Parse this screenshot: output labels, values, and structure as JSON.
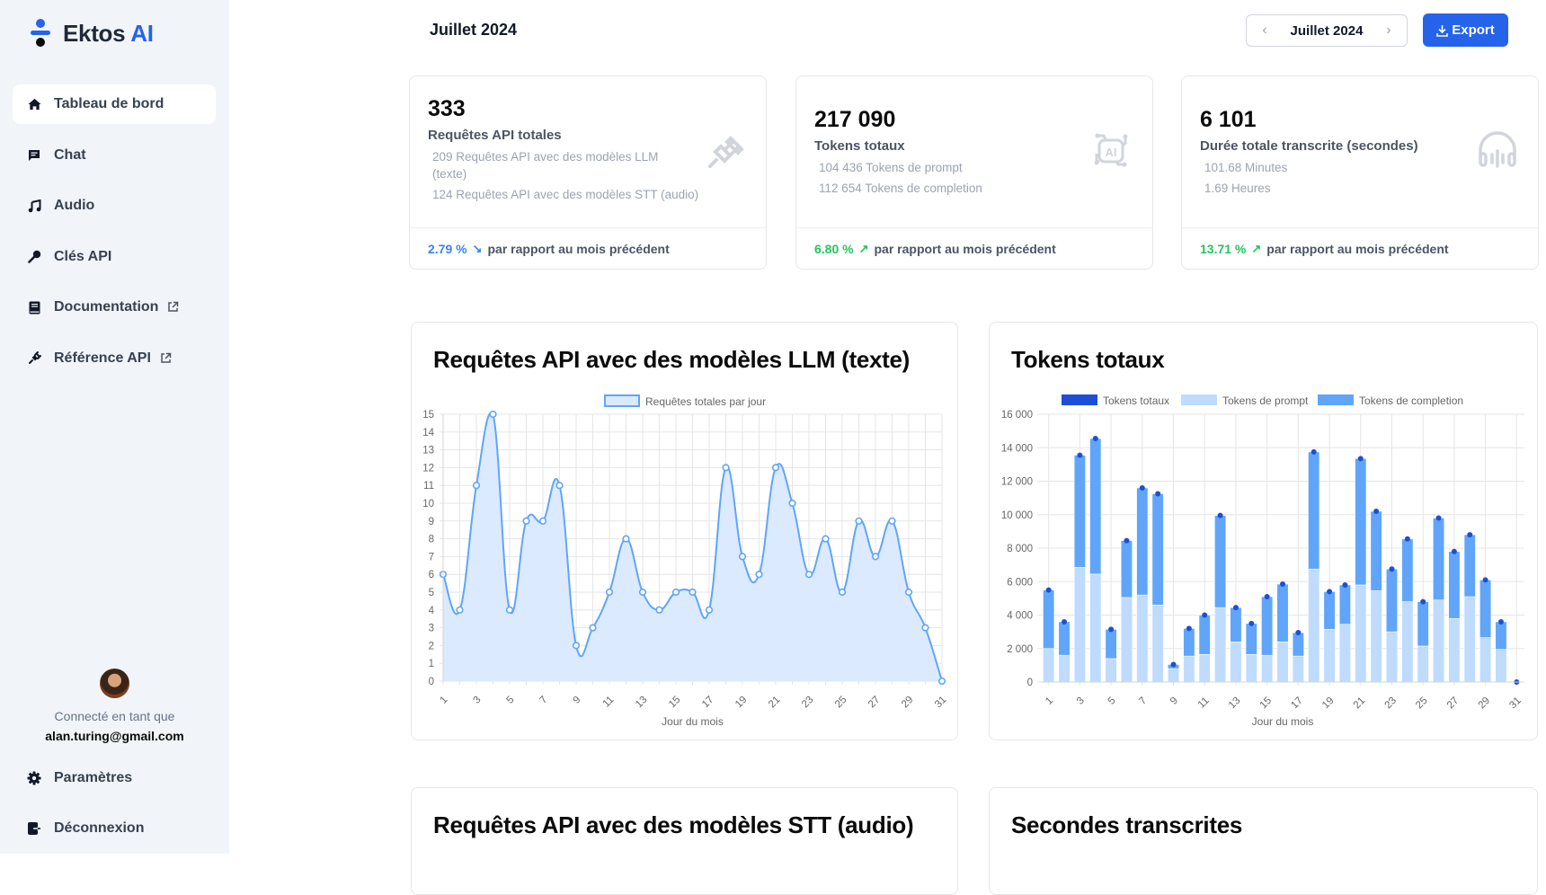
{
  "brand": {
    "name": "Ektos",
    "suffix": "AI"
  },
  "sidebar": {
    "items": [
      {
        "label": "Tableau de bord",
        "icon": "home-icon",
        "active": true
      },
      {
        "label": "Chat",
        "icon": "chat-icon"
      },
      {
        "label": "Audio",
        "icon": "music-icon"
      },
      {
        "label": "Clés API",
        "icon": "key-icon"
      },
      {
        "label": "Documentation",
        "icon": "book-icon",
        "external": true
      },
      {
        "label": "Référence API",
        "icon": "plug-icon",
        "external": true
      }
    ],
    "user": {
      "label": "Connecté en tant que",
      "email": "alan.turing@gmail.com"
    },
    "bottom": [
      {
        "label": "Paramètres",
        "icon": "gear-icon"
      },
      {
        "label": "Déconnexion",
        "icon": "logout-icon"
      }
    ]
  },
  "header": {
    "title": "Juillet 2024",
    "date_picker": {
      "value": "Juillet 2024",
      "prev": "‹",
      "next": "›"
    },
    "export_label": "Export"
  },
  "kpis": [
    {
      "value": "333",
      "label": "Requêtes API totales",
      "subs": [
        "209 Requêtes API avec des modèles LLM (texte)",
        "124 Requêtes API avec des modèles STT (audio)"
      ],
      "change": "2.79 %",
      "direction": "down",
      "arrow": "↘",
      "compare": "par rapport au mois précédent",
      "icon": "plug-icon"
    },
    {
      "value": "217 090",
      "label": "Tokens totaux",
      "subs": [
        "104 436 Tokens de prompt",
        "112 654 Tokens de completion"
      ],
      "change": "6.80 %",
      "direction": "up",
      "arrow": "↗",
      "compare": "par rapport au mois précédent",
      "icon": "ai-chip-icon"
    },
    {
      "value": "6 101",
      "label": "Durée totale transcrite (secondes)",
      "subs": [
        "101.68 Minutes",
        "1.69 Heures"
      ],
      "change": "13.71 %",
      "direction": "up",
      "arrow": "↗",
      "compare": "par rapport au mois précédent",
      "icon": "headphones-icon"
    }
  ],
  "bottom_cards": [
    {
      "title": "Requêtes API avec des modèles STT (audio)"
    },
    {
      "title": "Secondes transcrites"
    }
  ],
  "colors": {
    "accent": "#2563eb",
    "line": "#60a5fa",
    "area": "#dbeafe",
    "prompt": "#bfdbfe",
    "completion": "#60a5fa",
    "total": "#1d4ed8",
    "up": "#22c55e",
    "down": "#3b82f6"
  },
  "chart_data": [
    {
      "type": "area",
      "title": "Requêtes API avec des modèles LLM (texte)",
      "legend": [
        "Requêtes totales par jour"
      ],
      "legend_position": "top",
      "xlabel": "Jour du mois",
      "ylabel": "",
      "ylim": [
        0,
        15
      ],
      "y_ticks": [
        0,
        1,
        2,
        3,
        4,
        5,
        6,
        7,
        8,
        9,
        10,
        11,
        12,
        13,
        14,
        15
      ],
      "x_ticks": [
        1,
        3,
        5,
        7,
        9,
        11,
        13,
        15,
        17,
        19,
        21,
        23,
        25,
        27,
        29,
        31
      ],
      "grid": true,
      "x": [
        1,
        2,
        3,
        4,
        5,
        6,
        7,
        8,
        9,
        10,
        11,
        12,
        13,
        14,
        15,
        16,
        17,
        18,
        19,
        20,
        21,
        22,
        23,
        24,
        25,
        26,
        27,
        28,
        29,
        30,
        31
      ],
      "series": [
        {
          "name": "Requêtes totales par jour",
          "values": [
            6,
            4,
            11,
            15,
            4,
            9,
            9,
            11,
            2,
            3,
            5,
            8,
            5,
            4,
            5,
            5,
            4,
            12,
            7,
            6,
            12,
            10,
            6,
            8,
            5,
            9,
            7,
            9,
            5,
            3,
            0
          ]
        }
      ]
    },
    {
      "type": "bar",
      "stacked": true,
      "title": "Tokens totaux",
      "legend": [
        "Tokens totaux",
        "Tokens de prompt",
        "Tokens de completion"
      ],
      "legend_position": "top",
      "xlabel": "Jour du mois",
      "ylabel": "",
      "ylim": [
        0,
        16000
      ],
      "y_ticks": [
        "0",
        "2 000",
        "4 000",
        "6 000",
        "8 000",
        "10 000",
        "12 000",
        "14 000",
        "16 000"
      ],
      "x_ticks": [
        1,
        3,
        5,
        7,
        9,
        11,
        13,
        15,
        17,
        19,
        21,
        23,
        25,
        27,
        29,
        31
      ],
      "grid": true,
      "x": [
        1,
        2,
        3,
        4,
        5,
        6,
        7,
        8,
        9,
        10,
        11,
        12,
        13,
        14,
        15,
        16,
        17,
        18,
        19,
        20,
        21,
        22,
        23,
        24,
        25,
        26,
        27,
        28,
        29,
        30,
        31
      ],
      "series": [
        {
          "name": "Tokens totaux",
          "values": [
            5500,
            3600,
            13550,
            14550,
            3150,
            8450,
            11600,
            11250,
            1050,
            3200,
            4000,
            9950,
            4450,
            3500,
            5100,
            5850,
            2950,
            13750,
            5400,
            5800,
            13350,
            10200,
            6750,
            8550,
            4800,
            9800,
            7800,
            8800,
            6100,
            3600,
            0
          ]
        },
        {
          "name": "Tokens de prompt",
          "values": [
            2000,
            1600,
            6850,
            6450,
            1400,
            5050,
            5200,
            4600,
            800,
            1550,
            1650,
            4450,
            2400,
            1650,
            1600,
            2400,
            1550,
            6750,
            3150,
            3450,
            5800,
            5450,
            3000,
            4800,
            2150,
            4900,
            3800,
            5100,
            2650,
            1950,
            0
          ]
        },
        {
          "name": "Tokens de completion",
          "values": [
            3500,
            2000,
            6700,
            8100,
            1750,
            3400,
            6400,
            6650,
            250,
            1650,
            2350,
            5500,
            2050,
            1850,
            3500,
            3450,
            1400,
            7000,
            2250,
            2350,
            7550,
            4750,
            3750,
            3750,
            2650,
            4900,
            4000,
            3700,
            3450,
            1650,
            0
          ]
        }
      ]
    }
  ]
}
